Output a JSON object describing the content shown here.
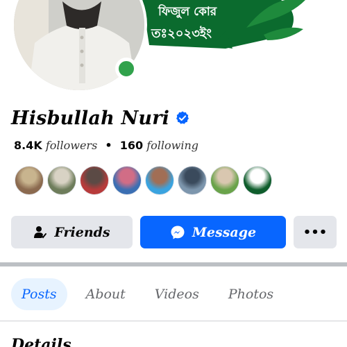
{
  "cover": {
    "banner_line1": "ফিজুল কোর",
    "banner_line2": "তঃ২০২৩ইং",
    "banner_color": "#0b6b2e"
  },
  "profile": {
    "name": "Hisbullah Nuri",
    "verified_icon": "verified-badge-icon",
    "online_color": "#31a24c",
    "followers_count": "8.4K",
    "followers_label": "followers",
    "separator": "•",
    "following_count": "160",
    "following_label": "following",
    "mutual_friends": [
      {
        "name": "friend-avatar-1",
        "colors": [
          "#8b6a4f",
          "#c8b48e"
        ]
      },
      {
        "name": "friend-avatar-2",
        "colors": [
          "#6e7d5b",
          "#d8d2c4"
        ]
      },
      {
        "name": "friend-avatar-3",
        "colors": [
          "#b73b3b",
          "#5b4a45"
        ]
      },
      {
        "name": "friend-avatar-4",
        "colors": [
          "#3b6fb3",
          "#d16d86"
        ]
      },
      {
        "name": "friend-avatar-5",
        "colors": [
          "#3aa3df",
          "#a16e55"
        ]
      },
      {
        "name": "friend-avatar-6",
        "colors": [
          "#7d96ad",
          "#3a4a5c"
        ]
      },
      {
        "name": "friend-avatar-7",
        "colors": [
          "#6aa34a",
          "#d9c7b0"
        ]
      },
      {
        "name": "friend-avatar-8",
        "colors": [
          "#0f5d2c",
          "#ffffff"
        ]
      }
    ]
  },
  "actions": {
    "friends_label": "Friends",
    "message_label": "Message",
    "more_label": "•••",
    "message_color": "#0866ff"
  },
  "tabs": [
    {
      "label": "Posts",
      "active": true
    },
    {
      "label": "About",
      "active": false
    },
    {
      "label": "Videos",
      "active": false
    },
    {
      "label": "Photos",
      "active": false
    }
  ],
  "section": {
    "details_title": "Details"
  }
}
